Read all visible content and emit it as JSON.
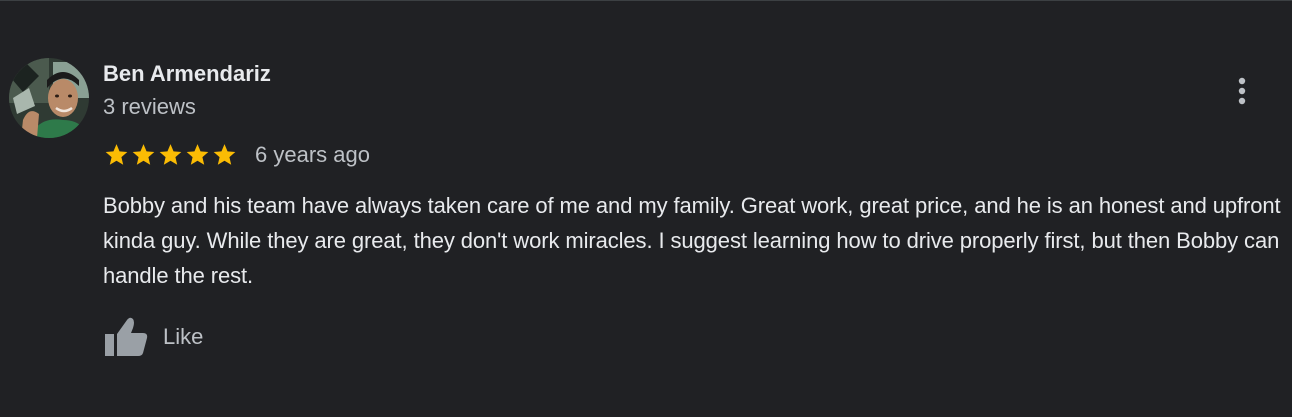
{
  "review": {
    "author_name": "Ben Armendariz",
    "review_count": "3 reviews",
    "rating": 5,
    "rating_max": 5,
    "date": "6 years ago",
    "text": "Bobby and his team have always taken care of me and my family. Great work, great price, and he is an honest and upfront kinda guy. While they are great, they don't work miracles. I suggest learning how to drive properly first, but then Bobby can handle the rest.",
    "like_label": "Like"
  },
  "icons": {
    "star": "star-icon",
    "more": "more-vert-icon",
    "like": "thumb-up-icon"
  },
  "colors": {
    "background": "#202124",
    "star": "#fbbc04",
    "text_primary": "#e8eaed",
    "text_secondary": "#bdc1c6",
    "icon": "#9aa0a6"
  }
}
